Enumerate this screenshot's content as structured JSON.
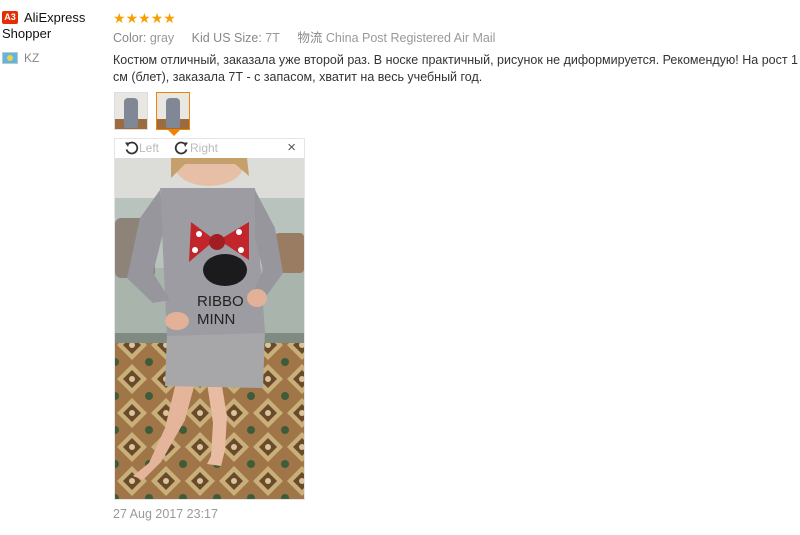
{
  "user": {
    "badge": "A3",
    "name": "AliExpress Shopper",
    "country_code": "KZ"
  },
  "review": {
    "rating": 5,
    "stars": [
      "★",
      "★",
      "★",
      "★",
      "★"
    ],
    "color_label": "Color:",
    "color_value": "gray",
    "size_label": "Kid US Size:",
    "size_value": "7T",
    "shipping_label": "物流",
    "shipping_value": "China Post Registered Air Mail",
    "text": "Костюм отличный, заказала уже второй раз. В носке практичный, рисунок не диформируется. Рекомендую! На рост 1 см (блет), заказала 7Т - с запасом, хватит на весь учебный год.",
    "date": "27 Aug 2017 23:17"
  },
  "viewer": {
    "rotate_left_label": "Left",
    "rotate_right_label": "Right",
    "close_glyph": "×",
    "shirt_text_line1": "RIBBO",
    "shirt_text_line2": "MINN"
  },
  "icons": {
    "rotate_left": "rotate-left-icon",
    "rotate_right": "rotate-right-icon",
    "close": "close-icon",
    "flag": "kazakhstan-flag-icon"
  },
  "colors": {
    "star": "#f7a000",
    "badge": "#e62e04",
    "active_thumb": "#f08400",
    "muted_text": "#999999"
  }
}
